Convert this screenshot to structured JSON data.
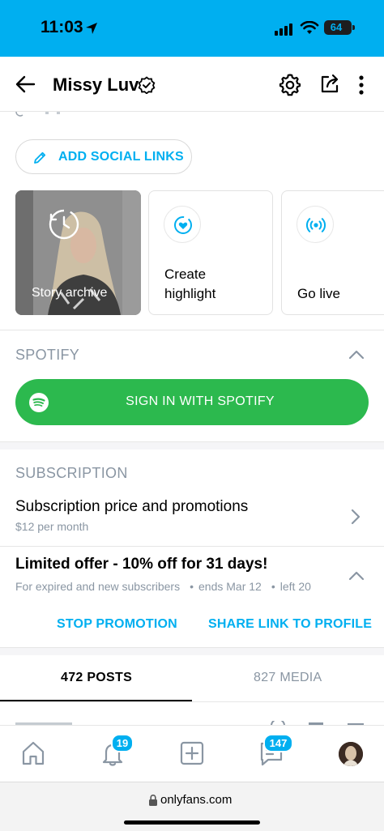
{
  "status_bar": {
    "time": "11:03",
    "battery": "64",
    "icons": [
      "location-arrow-icon",
      "signal-icon",
      "wifi-icon",
      "battery-icon"
    ]
  },
  "header": {
    "title": "Missy Luv",
    "icons": [
      "back-arrow-icon",
      "verified-badge-icon",
      "gear-icon",
      "share-icon",
      "more-vertical-icon"
    ]
  },
  "social": {
    "add_label": "ADD SOCIAL LINKS"
  },
  "highlights": {
    "story_archive": "Story archive",
    "create_line1": "Create",
    "create_line2": "highlight",
    "go_live": "Go live"
  },
  "spotify": {
    "section_title": "SPOTIFY",
    "sign_in_label": "SIGN IN WITH SPOTIFY",
    "brand_color": "#2cb94e"
  },
  "subscription": {
    "section_title": "SUBSCRIPTION",
    "price_title": "Subscription price and promotions",
    "price_sub": "$12 per month",
    "offer_title": "Limited offer - 10% off for 31 days!",
    "offer_audience": "For expired and new subscribers",
    "offer_ends": "ends Mar 12",
    "offer_left": "left 20",
    "stop_label": "STOP PROMOTION",
    "share_label": "SHARE LINK TO PROFILE"
  },
  "tabs": {
    "posts": "472 POSTS",
    "media": "827 MEDIA",
    "active": "posts"
  },
  "bottom_nav": {
    "notifications_badge": "19",
    "messages_badge": "147",
    "icons": [
      "home-icon",
      "bell-icon",
      "add-post-icon",
      "messages-icon",
      "avatar"
    ]
  },
  "browser": {
    "url": "onlyfans.com"
  },
  "colors": {
    "accent": "#00aff0",
    "muted_text": "#8a96a3"
  }
}
